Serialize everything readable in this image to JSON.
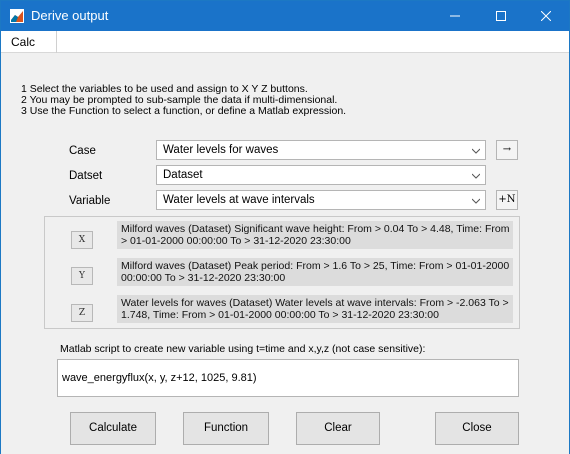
{
  "window": {
    "title": "Derive output"
  },
  "menu": {
    "items": [
      "Calc"
    ]
  },
  "instructions": {
    "line1": "1 Select the variables to be used and assign to X Y Z buttons.",
    "line2": "2 You may be prompted to sub-sample the data if multi-dimensional.",
    "line3": "3 Use the Function to select a function, or define a Matlab expression."
  },
  "case": {
    "label": "Case",
    "value": "Water levels for waves",
    "button": "→"
  },
  "dataset": {
    "label": "Datset",
    "value": "Dataset"
  },
  "variable": {
    "label": "Variable",
    "value": "Water levels at wave intervals",
    "button": "+N"
  },
  "assignments": [
    {
      "button": "X",
      "description": "Milford waves (Dataset) Significant wave height: From > 0.04 To > 4.48, Time: From > 01-01-2000 00:00:00 To > 31-12-2020 23:30:00"
    },
    {
      "button": "Y",
      "description": "Milford waves (Dataset) Peak period: From > 1.6 To > 25, Time: From > 01-01-2000 00:00:00 To > 31-12-2020 23:30:00"
    },
    {
      "button": "Z",
      "description": "Water levels for waves (Dataset) Water levels at wave intervals: From > -2.063 To > 1.748, Time: From > 01-01-2000 00:00:00 To > 31-12-2020 23:30:00"
    }
  ],
  "script": {
    "label": "Matlab script to create new variable using t=time and x,y,z (not case sensitive):",
    "value": "wave_energyflux(x, y, z+12, 1025, 9.81)"
  },
  "buttons": {
    "calculate": "Calculate",
    "function": "Function",
    "clear": "Clear",
    "close": "Close"
  },
  "colors": {
    "titlebar": "#1a73c9",
    "window_bg": "#f0f0f0"
  }
}
